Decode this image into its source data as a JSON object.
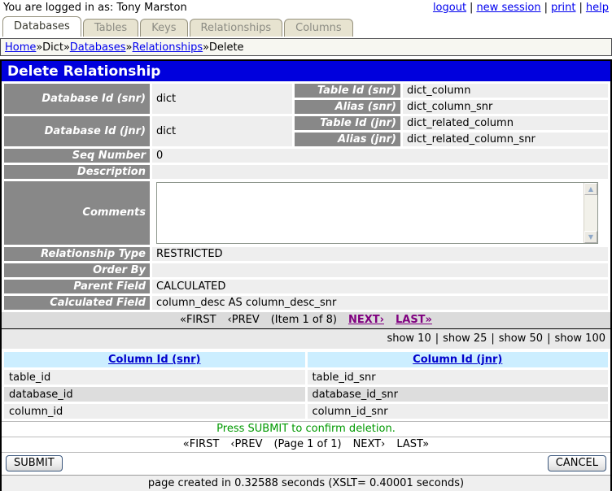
{
  "separators": {
    "pipe": "|"
  },
  "icons": {
    "scroll_up": "▲",
    "scroll_down": "▼"
  },
  "colors": {
    "title_bar_bg": "#0000DD",
    "label_bg": "#888888",
    "link_blue": "#0000EE",
    "link_purple": "#800080",
    "header_blue": "#CCEEFF",
    "message_green": "#009900",
    "tab_bg": "#E7E3D0"
  },
  "header": {
    "login_text": "You are logged in as: Tony Marston",
    "links": [
      "logout",
      "new session",
      "print",
      "help"
    ]
  },
  "tabs": [
    {
      "label": "Databases",
      "active": true
    },
    {
      "label": "Tables",
      "active": false
    },
    {
      "label": "Keys",
      "active": false
    },
    {
      "label": "Relationships",
      "active": false
    },
    {
      "label": "Columns",
      "active": false
    }
  ],
  "breadcrumb": {
    "separator": "»",
    "items": [
      {
        "label": "Home",
        "link": true
      },
      {
        "label": "Dict",
        "link": false
      },
      {
        "label": "Databases",
        "link": true
      },
      {
        "label": "Relationships",
        "link": true
      },
      {
        "label": "Delete",
        "link": false
      }
    ]
  },
  "title": "Delete Relationship",
  "form": {
    "snr": {
      "label": "Database Id (snr)",
      "value": "dict",
      "table_label": "Table Id (snr)",
      "table_value": "dict_column",
      "alias_label": "Alias (snr)",
      "alias_value": "dict_column_snr"
    },
    "jnr": {
      "label": "Database Id (jnr)",
      "value": "dict",
      "table_label": "Table Id (jnr)",
      "table_value": "dict_related_column",
      "alias_label": "Alias (jnr)",
      "alias_value": "dict_related_column_snr"
    },
    "seq_number": {
      "label": "Seq Number",
      "value": "0"
    },
    "description": {
      "label": "Description",
      "value": ""
    },
    "comments": {
      "label": "Comments",
      "value": ""
    },
    "relationship_type": {
      "label": "Relationship Type",
      "value": "RESTRICTED"
    },
    "order_by": {
      "label": "Order By",
      "value": ""
    },
    "parent_field": {
      "label": "Parent Field",
      "value": "CALCULATED"
    },
    "calculated_field": {
      "label": "Calculated Field",
      "value": "column_desc AS column_desc_snr"
    }
  },
  "item_pagination": {
    "first": "«FIRST",
    "prev": "‹PREV",
    "status": "(Item 1 of 8)",
    "next": "NEXT›",
    "last": "LAST»"
  },
  "show_options": [
    "show 10",
    "show 25",
    "show 50",
    "show 100"
  ],
  "columns_table": {
    "headers": [
      "Column Id (snr)",
      "Column Id (jnr)"
    ],
    "rows": [
      [
        "table_id",
        "table_id_snr"
      ],
      [
        "database_id",
        "database_id_snr"
      ],
      [
        "column_id",
        "column_id_snr"
      ]
    ]
  },
  "message": "Press SUBMIT to confirm deletion.",
  "page_pagination": {
    "first": "«FIRST",
    "prev": "‹PREV",
    "status": "(Page 1 of 1)",
    "next": "NEXT›",
    "last": "LAST»"
  },
  "buttons": {
    "submit": "SUBMIT",
    "cancel": "CANCEL"
  },
  "footer": "page created in 0.32588 seconds (XSLT= 0.40001 seconds)"
}
